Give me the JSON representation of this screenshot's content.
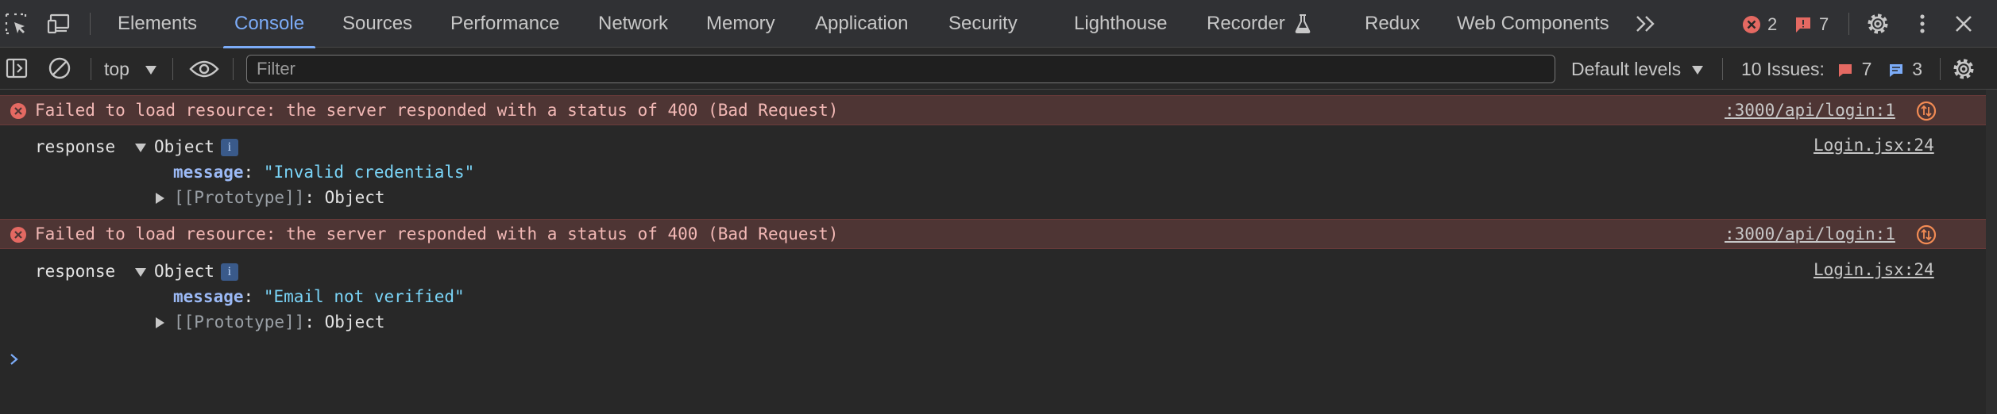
{
  "tabs": [
    "Elements",
    "Console",
    "Sources",
    "Performance",
    "Network",
    "Memory",
    "Application",
    "Security",
    "Lighthouse",
    "Recorder",
    "Redux",
    "Web Components"
  ],
  "active_tab": "Console",
  "counters": {
    "errors": "2",
    "warnings": "7"
  },
  "toolbar": {
    "context": "top",
    "filter_placeholder": "Filter",
    "levels": "Default levels",
    "issues_label": "10 Issues:",
    "issues_errors": "7",
    "issues_info": "3"
  },
  "messages": [
    {
      "error": "Failed to load resource: the server responded with a status of 400 (Bad Request)",
      "error_source": ":3000/api/login:1",
      "log_label": "response",
      "object_label": "Object",
      "info_badge": "i",
      "prop_key": "message",
      "prop_value": "\"Invalid credentials\"",
      "proto_label": "[[Prototype]]",
      "proto_value": ": Object",
      "log_source": "Login.jsx:24"
    },
    {
      "error": "Failed to load resource: the server responded with a status of 400 (Bad Request)",
      "error_source": ":3000/api/login:1",
      "log_label": "response",
      "object_label": "Object",
      "info_badge": "i",
      "prop_key": "message",
      "prop_value": "\"Email not verified\"",
      "proto_label": "[[Prototype]]",
      "proto_value": ": Object",
      "log_source": "Login.jsx:24"
    }
  ],
  "colors": {
    "accent": "#7cacf8",
    "error": "#e46962",
    "error_bg": "#4e3534",
    "warning": "#f28b54"
  },
  "icons": [
    "inspect-element-icon",
    "device-toolbar-icon",
    "more-tabs-icon",
    "error-icon",
    "warning-flag-icon",
    "settings-gear-icon",
    "more-vert-icon",
    "close-icon",
    "sidebar-toggle-icon",
    "clear-console-icon",
    "dropdown-arrow-icon",
    "live-expression-eye-icon",
    "chat-icon",
    "flask-icon",
    "network-request-icon",
    "console-prompt-icon"
  ]
}
